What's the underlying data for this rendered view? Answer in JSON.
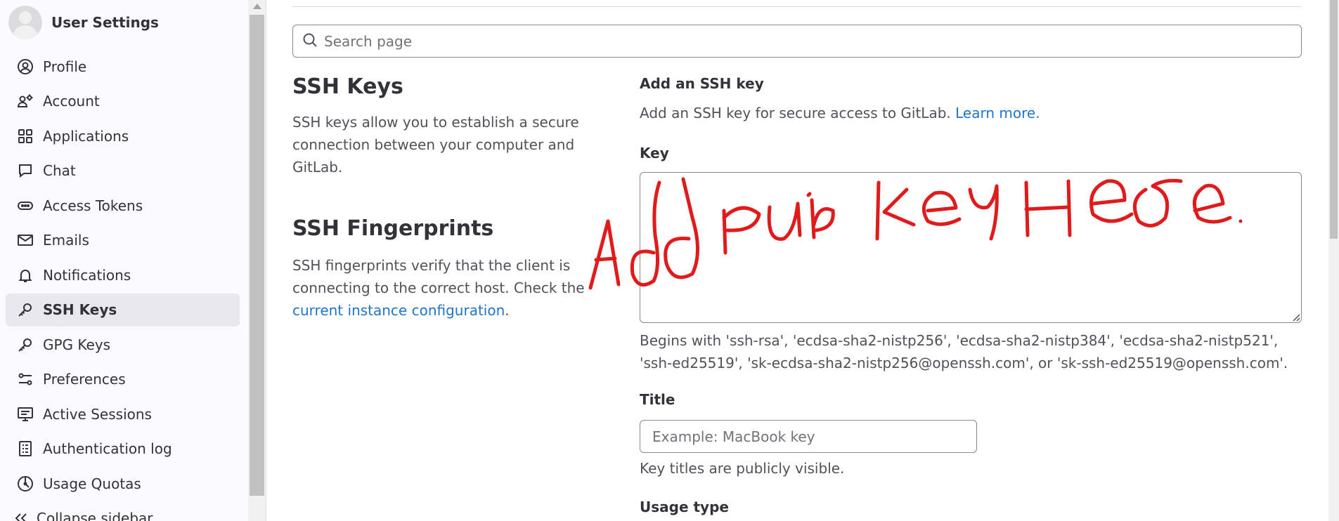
{
  "sidebar": {
    "title": "User Settings",
    "items": [
      {
        "label": "Profile",
        "icon": "profile-icon"
      },
      {
        "label": "Account",
        "icon": "account-icon"
      },
      {
        "label": "Applications",
        "icon": "applications-icon"
      },
      {
        "label": "Chat",
        "icon": "chat-icon"
      },
      {
        "label": "Access Tokens",
        "icon": "token-icon"
      },
      {
        "label": "Emails",
        "icon": "mail-icon"
      },
      {
        "label": "Notifications",
        "icon": "bell-icon"
      },
      {
        "label": "SSH Keys",
        "icon": "key-icon",
        "active": true
      },
      {
        "label": "GPG Keys",
        "icon": "key-icon"
      },
      {
        "label": "Preferences",
        "icon": "preferences-icon"
      },
      {
        "label": "Active Sessions",
        "icon": "monitor-icon"
      },
      {
        "label": "Authentication log",
        "icon": "log-icon"
      },
      {
        "label": "Usage Quotas",
        "icon": "quota-icon"
      }
    ],
    "collapse_label": "Collapse sidebar"
  },
  "search": {
    "placeholder": "Search page"
  },
  "ssh_keys": {
    "heading": "SSH Keys",
    "description": "SSH keys allow you to establish a secure connection between your computer and GitLab."
  },
  "fingerprints": {
    "heading": "SSH Fingerprints",
    "description_prefix": "SSH fingerprints verify that the client is connecting to the correct host. Check the ",
    "link": "current instance configuration",
    "description_suffix": "."
  },
  "form": {
    "section_title": "Add an SSH key",
    "intro": "Add an SSH key for secure access to GitLab.",
    "learn_more": "Learn more.",
    "key_label": "Key",
    "key_help": "Begins with 'ssh-rsa', 'ecdsa-sha2-nistp256', 'ecdsa-sha2-nistp384', 'ecdsa-sha2-nistp521', 'ssh-ed25519', 'sk-ecdsa-sha2-nistp256@openssh.com', or 'sk-ssh-ed25519@openssh.com'.",
    "title_label": "Title",
    "title_placeholder": "Example: MacBook key",
    "title_help": "Key titles are publicly visible.",
    "usage_label": "Usage type"
  },
  "annotation": {
    "handwritten_text": "Add pub key here .",
    "color": "#e01b1b"
  },
  "colors": {
    "accent": "#1f75cb",
    "active_bg": "#e9e8ee"
  }
}
